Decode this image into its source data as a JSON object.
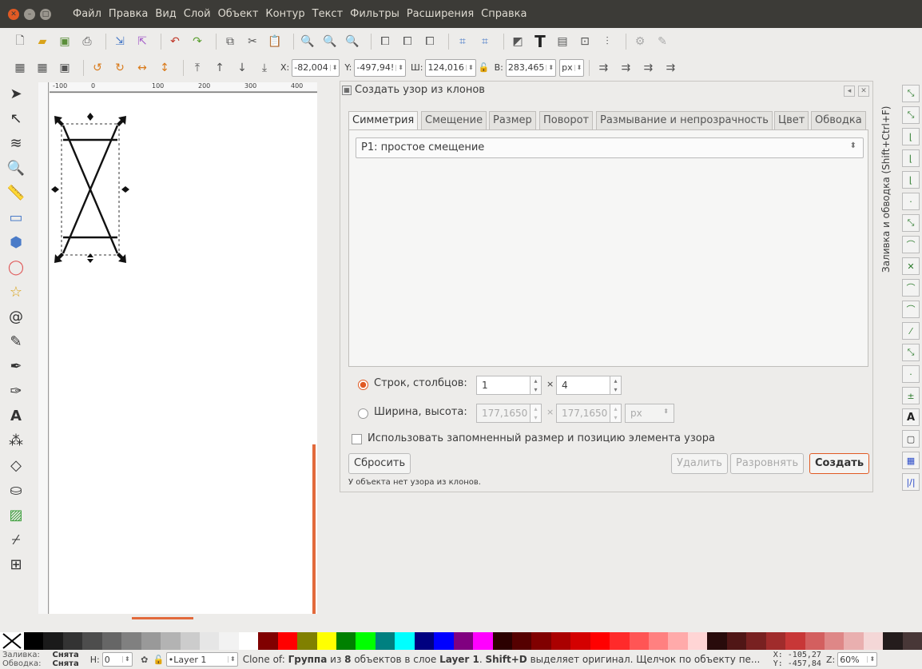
{
  "menubar": {
    "items": [
      "Файл",
      "Правка",
      "Вид",
      "Слой",
      "Объект",
      "Контур",
      "Текст",
      "Фильтры",
      "Расширения",
      "Справка"
    ]
  },
  "toolbar2": {
    "x_label": "X:",
    "x_value": "-82,004",
    "y_label": "Y:",
    "y_value": "-497,94!",
    "w_label": "Ш:",
    "w_value": "124,016",
    "h_label": "В:",
    "h_value": "283,465",
    "unit": "px"
  },
  "ruler": {
    "h_ticks": [
      "-100",
      "0",
      "100",
      "200",
      "300",
      "400"
    ]
  },
  "dialog": {
    "title": "Создать узор из клонов",
    "tabs": [
      "Симметрия",
      "Смещение",
      "Размер",
      "Поворот",
      "Размывание и непрозрачность",
      "Цвет",
      "Обводка"
    ],
    "symmetry_value": "P1: простое смещение",
    "rows_cols_label": "Строк, столбцов:",
    "rows": "1",
    "cols": "4",
    "times": "×",
    "width_height_label": "Ширина, высота:",
    "width": "177,1650",
    "height": "177,1650",
    "wh_unit": "px",
    "remember_label": "Использовать запомненный размер и позицию элемента узора",
    "reset_label": "Сбросить",
    "delete_label": "Удалить",
    "unclump_label": "Разровнять",
    "create_label": "Создать",
    "status": "У объекта нет узора из клонов."
  },
  "side_tab": "Заливка и обводка (Shift+Ctrl+F)",
  "palette": [
    "#000000",
    "#1a1a1a",
    "#333333",
    "#4d4d4d",
    "#666666",
    "#808080",
    "#999999",
    "#b3b3b3",
    "#cccccc",
    "#e6e6e6",
    "#f2f2f2",
    "#ffffff",
    "#800000",
    "#ff0000",
    "#808000",
    "#ffff00",
    "#008000",
    "#00ff00",
    "#008080",
    "#00ffff",
    "#000080",
    "#0000ff",
    "#800080",
    "#ff00ff",
    "#2b0000",
    "#550000",
    "#800000",
    "#aa0000",
    "#d40000",
    "#ff0000",
    "#ff2a2a",
    "#ff5555",
    "#ff8080",
    "#ffaaaa",
    "#ffd5d5",
    "#280b0b",
    "#501616",
    "#782121",
    "#a02c2c",
    "#c83737",
    "#d35f5f",
    "#de8787",
    "#e9afaf",
    "#f4d7d7",
    "#241c1c",
    "#483737"
  ],
  "status": {
    "fill_label": "Заливка:",
    "fill_value": "Снята",
    "stroke_label": "Обводка:",
    "stroke_value": "Снята",
    "h_label": "H:",
    "h_value": "0",
    "layer": "•Layer 1",
    "msg_pre": "Clone of: ",
    "msg_b1": "Группа",
    "msg_mid1": " из ",
    "msg_b2": "8",
    "msg_mid2": " объектов в слое ",
    "msg_b3": "Layer 1",
    "msg_mid3": ". ",
    "msg_b4": "Shift+D",
    "msg_end": " выделяет оригинал. Щелчок по объекту пе...",
    "cx": "X: -105,27",
    "cy": "Y: -457,84",
    "zoom_label": "Z:",
    "zoom": "60%"
  }
}
